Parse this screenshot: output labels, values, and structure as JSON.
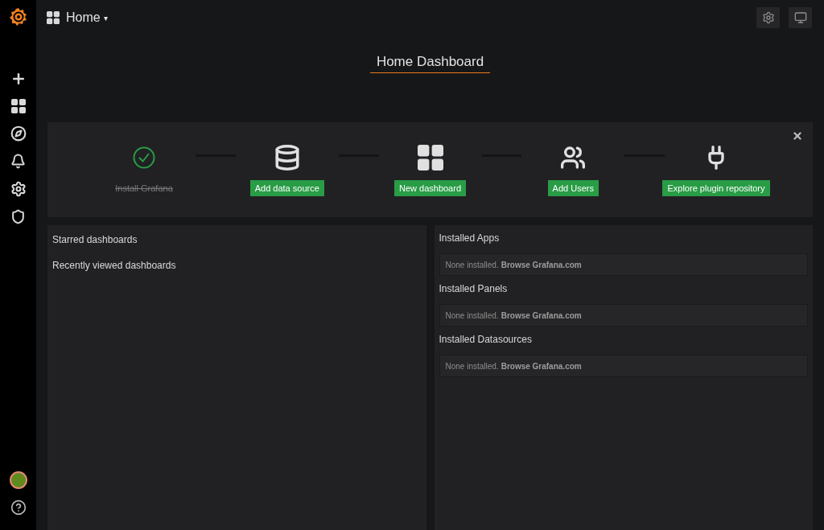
{
  "header": {
    "title": "Home",
    "caret": "▾"
  },
  "dashboard_title": "Home Dashboard",
  "steps": [
    {
      "kind": "check",
      "label": "Install Grafana",
      "done": true
    },
    {
      "kind": "database",
      "label": "Add data source",
      "done": false
    },
    {
      "kind": "grid",
      "label": "New dashboard",
      "done": false
    },
    {
      "kind": "users",
      "label": "Add Users",
      "done": false
    },
    {
      "kind": "plug",
      "label": "Explore plugin repository",
      "done": false
    }
  ],
  "left_panel": {
    "sections": [
      "Starred dashboards",
      "Recently viewed dashboards"
    ]
  },
  "right_panel": {
    "sections": [
      {
        "title": "Installed Apps",
        "text": "None installed.",
        "link": "Browse Grafana.com"
      },
      {
        "title": "Installed Panels",
        "text": "None installed.",
        "link": "Browse Grafana.com"
      },
      {
        "title": "Installed Datasources",
        "text": "None installed.",
        "link": "Browse Grafana.com"
      }
    ]
  }
}
